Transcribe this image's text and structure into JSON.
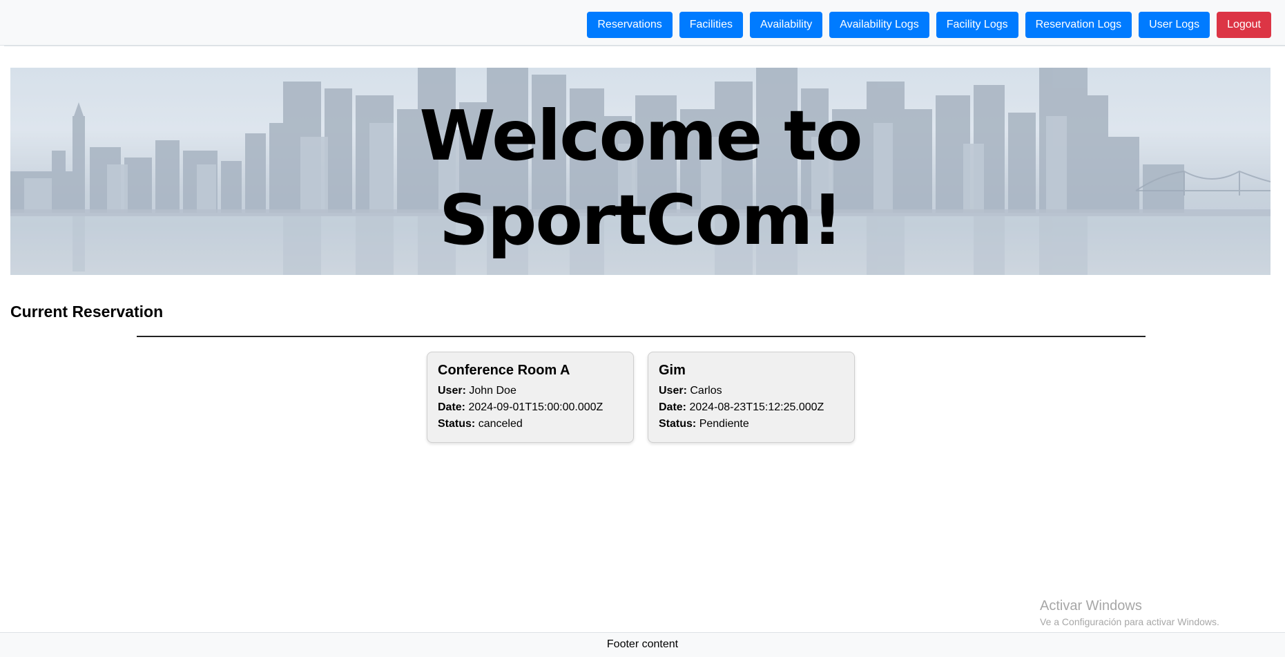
{
  "nav": {
    "buttons": [
      {
        "label": "Reservations",
        "style": "primary"
      },
      {
        "label": "Facilities",
        "style": "primary"
      },
      {
        "label": "Availability",
        "style": "primary"
      },
      {
        "label": "Availability Logs",
        "style": "primary"
      },
      {
        "label": "Facility Logs",
        "style": "primary"
      },
      {
        "label": "Reservation Logs",
        "style": "primary"
      },
      {
        "label": "User Logs",
        "style": "primary"
      },
      {
        "label": "Logout",
        "style": "danger"
      }
    ]
  },
  "hero": {
    "line1": "Welcome to",
    "line2": "SportCom!"
  },
  "section": {
    "title": "Current Reservation"
  },
  "reservations": [
    {
      "facility": "Conference Room A",
      "user_label": "User:",
      "user": "John Doe",
      "date_label": "Date:",
      "date": "2024-09-01T15:00:00.000Z",
      "status_label": "Status:",
      "status": "canceled"
    },
    {
      "facility": "Gim",
      "user_label": "User:",
      "user": "Carlos",
      "date_label": "Date:",
      "date": "2024-08-23T15:12:25.000Z",
      "status_label": "Status:",
      "status": "Pendiente"
    }
  ],
  "watermark": {
    "line1": "Activar Windows",
    "line2": "Ve a Configuración para activar Windows."
  },
  "footer": {
    "text": "Footer content"
  },
  "colors": {
    "primary": "#007bff",
    "danger": "#dc3545",
    "navbar_bg": "#f8f9fa",
    "card_bg": "#f0f0f0"
  }
}
